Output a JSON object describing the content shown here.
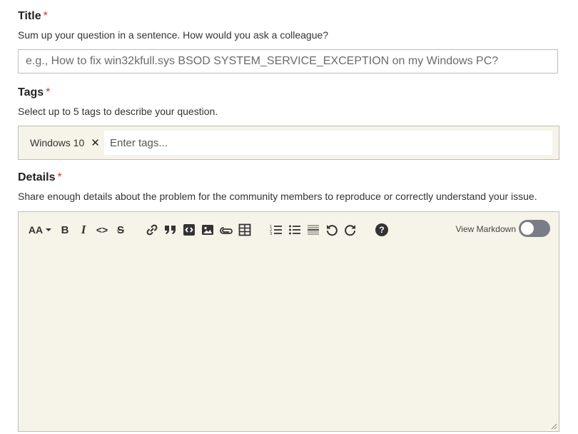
{
  "title_section": {
    "label": "Title",
    "required_mark": "*",
    "help": "Sum up your question in a sentence. How would you ask a colleague?",
    "input_value": "",
    "placeholder": "e.g., How to fix win32kfull.sys BSOD SYSTEM_SERVICE_EXCEPTION on my Windows PC?"
  },
  "tags_section": {
    "label": "Tags",
    "required_mark": "*",
    "help": "Select up to 5 tags to describe your question.",
    "tags": [
      {
        "label": "Windows 10",
        "remove_glyph": "✕"
      }
    ],
    "input_value": "",
    "placeholder": "Enter tags..."
  },
  "details_section": {
    "label": "Details",
    "required_mark": "*",
    "help": "Share enough details about the problem for the community members to reproduce or correctly understand your issue.",
    "toolbar": {
      "font_size_glyph": "AA",
      "bold_glyph": "B",
      "italic_glyph": "I",
      "code_glyph": "<>",
      "strike_glyph": "S",
      "help_glyph": "?",
      "icons": [
        "font-size-icon",
        "bold-icon",
        "italic-icon",
        "code-icon",
        "strikethrough-icon",
        "link-icon",
        "quote-icon",
        "code-block-icon",
        "image-icon",
        "attachment-icon",
        "table-icon",
        "numbered-list-icon",
        "bulleted-list-icon",
        "horizontal-rule-icon",
        "undo-icon",
        "redo-icon",
        "help-icon"
      ]
    },
    "view_markdown_label": "View Markdown",
    "view_markdown_enabled": false,
    "body_text": ""
  },
  "colors": {
    "required": "#d9342b",
    "field_background": "#f6f3e8",
    "border": "#bdbdbd",
    "toggle_off": "#7a7d85"
  }
}
